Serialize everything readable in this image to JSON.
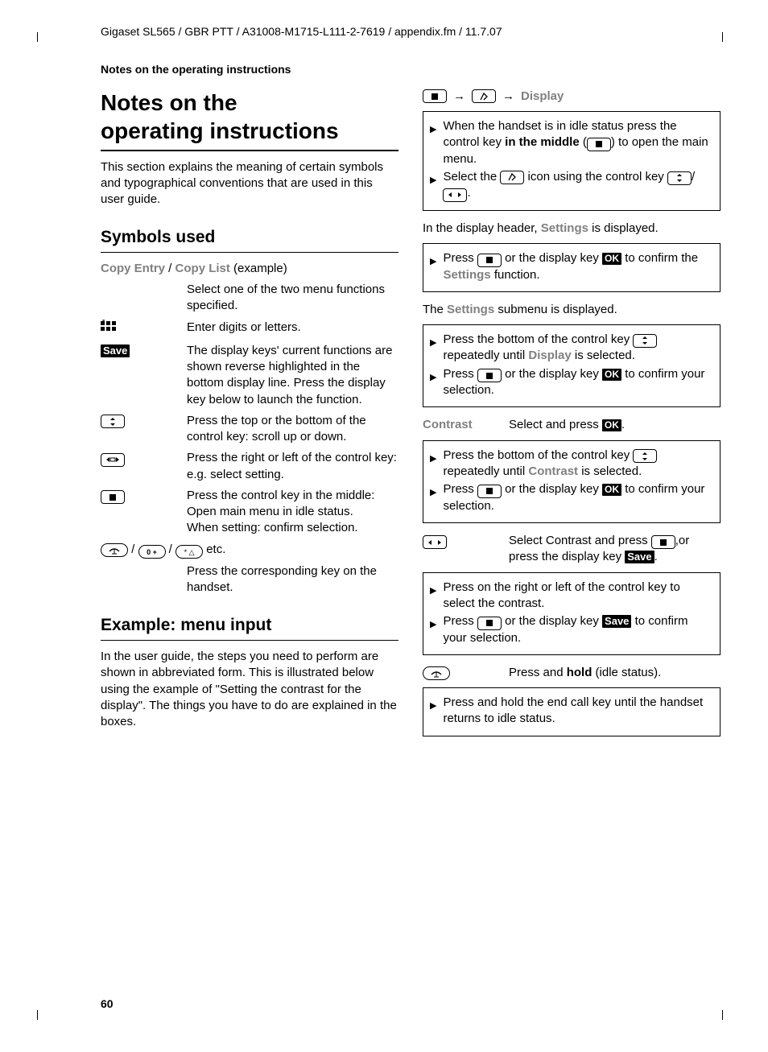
{
  "header": {
    "running_head": "Gigaset SL565 / GBR PTT / A31008-M1715-L111-2-7619 / appendix.fm / 11.7.07",
    "section_label": "Notes on the operating instructions",
    "page_number": "60"
  },
  "left": {
    "h1_line1": "Notes on the",
    "h1_line2": "operating instructions",
    "intro": "This section explains the meaning of certain symbols and typographical conventions that are used in this user guide.",
    "h2_symbols": "Symbols used",
    "sym_copy_label_a": "Copy Entry",
    "sym_copy_sep": " / ",
    "sym_copy_label_b": "Copy List",
    "sym_copy_example": " (example)",
    "sym_copy_desc": "Select one of the two menu functions specified.",
    "sym_keypad_desc": "Enter digits or letters.",
    "sym_save_label": "Save",
    "sym_save_desc": "The display keys' current functions are shown reverse highlighted in the bottom display line. Press the display key below to launch the function.",
    "sym_updown_desc": "Press the top or the bottom of the control key: scroll up or down.",
    "sym_leftright_desc": "Press the right or left of the control key: e.g. select setting.",
    "sym_center_desc1": "Press the control key in the middle: Open main menu in idle status.",
    "sym_center_desc2": "When setting: confirm selection.",
    "sym_keys_etc": " etc.",
    "sym_keys_desc": "Press the corresponding key on the handset.",
    "h2_example": "Example: menu input",
    "example_para": "In the user guide, the steps you need to perform are shown in abbreviated form. This is illustrated below using the example of \"Setting the contrast for the display\". The things you have to do are explained in the boxes."
  },
  "right": {
    "menu_display": "Display",
    "box1_s1a": "When the handset is in idle status press the control key ",
    "box1_s1b": "in the middle",
    "box1_s1c": " (",
    "box1_s1d": ") to open the main menu.",
    "box1_s2a": "Select the ",
    "box1_s2b": " icon using the control key ",
    "box1_s2c": "/",
    "box1_s2d": ".",
    "line1a": "In the display header, ",
    "line1b": "Settings",
    "line1c": "  is displayed.",
    "box2_s1a": "Press ",
    "box2_s1b": " or the display key ",
    "box2_s1c": " to confirm the ",
    "box2_s1d": "Settings",
    "box2_s1e": "  function.",
    "line2a": "The ",
    "line2b": "Settings",
    "line2c": "  submenu is displayed.",
    "box3_s1a": "Press the bottom of the control key ",
    "box3_s1b": " repeatedly until ",
    "box3_s1c": "Display",
    "box3_s1d": " is selected.",
    "box3_s2a": "Press ",
    "box3_s2b": " or the display key ",
    "box3_s2c": " to confirm your selection.",
    "contrast_label": "Contrast",
    "contrast_text_a": "Select and press ",
    "contrast_text_b": ".",
    "box4_s1a": "Press the bottom of the control key ",
    "box4_s1b": " repeatedly until ",
    "box4_s1c": "Contrast",
    "box4_s1d": " is selected.",
    "box4_s2a": "Press ",
    "box4_s2b": " or the display key ",
    "box4_s2c": " to confirm your selection.",
    "lr_desc_a": "Select Contrast and press ",
    "lr_desc_b": ",or press the display key ",
    "lr_desc_c": ".",
    "save_label": "Save",
    "box5_s1": "Press on the right or left of the control key to select the contrast.",
    "box5_s2a": "Press ",
    "box5_s2b": " or the display key ",
    "box5_s2c": " to confirm your selection.",
    "hold_a": "Press and ",
    "hold_b": "hold",
    "hold_c": " (idle status).",
    "box6_s1": "Press and hold the end call key until the handset returns to idle status.",
    "ok_label": "OK"
  }
}
